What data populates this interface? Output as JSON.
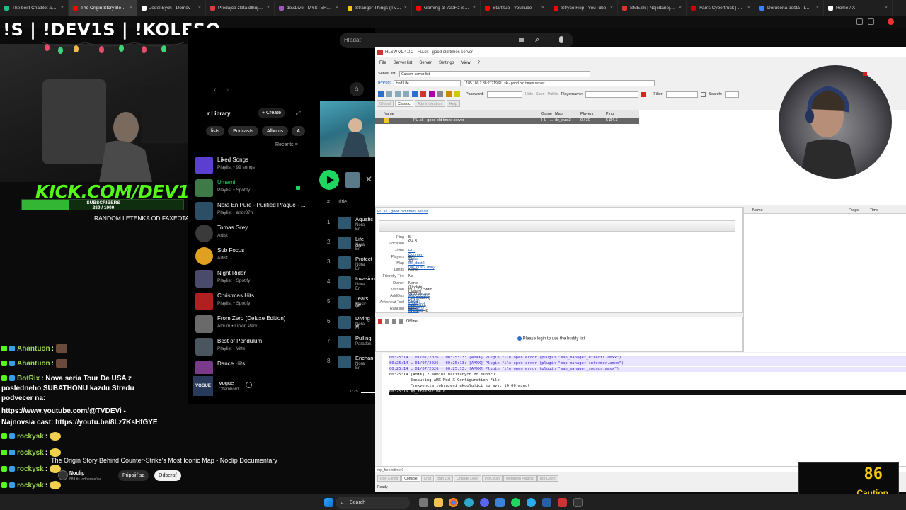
{
  "browser": {
    "tabs": [
      {
        "label": "The best ChatBot and ...",
        "color": "#19c37d"
      },
      {
        "label": "The Origin Story Behind ...",
        "color": "#ff0000",
        "active": true
      },
      {
        "label": "Jedel Bych - Domov",
        "color": "#ffffff"
      },
      {
        "label": "Predajca zlata dlhuje d...",
        "color": "#e03c3c"
      },
      {
        "label": "dev1live - MYSTERYBO...",
        "color": "#9b59b6"
      },
      {
        "label": "Stranger Things (TV Se...",
        "color": "#f5c518"
      },
      {
        "label": "Gaming at 720Hz is insa...",
        "color": "#ff0000"
      },
      {
        "label": "Startitup - YouTube",
        "color": "#ff0000"
      },
      {
        "label": "Strýco Filip - YouTube",
        "color": "#ff0000"
      },
      {
        "label": "SME.sk | Najčítanejšie s...",
        "color": "#e8302a"
      },
      {
        "label": "Ivan's Cybertruck | Tesla",
        "color": "#cc0000"
      },
      {
        "label": "Doručená pošta - Lazo...",
        "color": "#3b82f6"
      },
      {
        "label": "Home / X",
        "color": "#ffffff"
      }
    ]
  },
  "overlay": {
    "title": "!S | !DEV1S | !KOLESO",
    "kick": "KICK.COM/DEV1",
    "subs_label": "SUBSCRIBERS",
    "subs_count": "289 / 1000",
    "subs_progress": 0.289,
    "random_text": "RANDOM LETENKA OD FAXEOTA"
  },
  "chat": [
    {
      "user": "Ahantuon",
      "text": ":"
    },
    {
      "user": "Ahantuon",
      "text": ":"
    },
    {
      "user": "BotRix",
      "text": ": Nova seria Tour De USA z"
    },
    {
      "user": "",
      "text": "posledneho SUBATHONU kazdu Stredu"
    },
    {
      "user": "",
      "text": "podvecer na:"
    },
    {
      "user": "",
      "text": "https://www.youtube.com/@TVDEVi -"
    },
    {
      "user": "",
      "text": "Najnovsia cast: https://youtu.be/8Lz7KsHfGYE"
    },
    {
      "user": "rockysk",
      "text": ":"
    },
    {
      "user": "rockysk",
      "text": ":"
    },
    {
      "user": "rockysk",
      "text": ":"
    },
    {
      "user": "rockysk",
      "text": ":"
    },
    {
      "user": "rockysk",
      "text": ":"
    }
  ],
  "spotify": {
    "search_placeholder": "Hľadať",
    "library_title": "r Library",
    "create_label": "+ Create",
    "filters": [
      "lists",
      "Podcasts",
      "Albums",
      "A"
    ],
    "recents": "Recents",
    "items": [
      {
        "title": "Liked Songs",
        "sub": "Playlist • 99 songs",
        "color": "#5b3fd0"
      },
      {
        "title": "Umami",
        "sub": "Playlist • Spotify",
        "color": "#3d7a48",
        "active": true
      },
      {
        "title": "Nora En Pure - Purified Prague - ...",
        "sub": "Playlist • andr87h",
        "color": "#2d4f66"
      },
      {
        "title": "Tomas Grey",
        "sub": "Artist",
        "color": "#3a3a3a"
      },
      {
        "title": "Sub Focus",
        "sub": "Artist",
        "color": "#e0a020"
      },
      {
        "title": "Night Rider",
        "sub": "Playlist • Spotify",
        "color": "#4a4a6a"
      },
      {
        "title": "Christmas Hits",
        "sub": "Playlist • Spotify",
        "color": "#b02020"
      },
      {
        "title": "From Zero (Deluxe Edition)",
        "sub": "Album • Linkin Park",
        "color": "#6a6a6a"
      },
      {
        "title": "Best of Pendulum",
        "sub": "Playlist • Vifte",
        "color": "#4a5560"
      },
      {
        "title": "Dance Hits",
        "sub": "",
        "color": "#7a3a8a"
      }
    ],
    "track_header": "Title",
    "tracks": [
      {
        "num": "1",
        "title": "Aquatic",
        "artist": "Nora En"
      },
      {
        "num": "2",
        "title": "Life on",
        "artist": "Nora En"
      },
      {
        "num": "3",
        "title": "Protect",
        "artist": "Nora En"
      },
      {
        "num": "4",
        "title": "Invasion",
        "artist": "Nora En"
      },
      {
        "num": "5",
        "title": "Tears (w",
        "artist": "Music"
      },
      {
        "num": "6",
        "title": "Diving w",
        "artist": "Nora En"
      },
      {
        "num": "7",
        "title": "Pulling",
        "artist": "Paradok"
      },
      {
        "num": "8",
        "title": "Enchan",
        "artist": "Nora En"
      }
    ],
    "now_playing": {
      "title": "Vogue",
      "artist": "Chambord",
      "time": "0:25"
    }
  },
  "hlsw": {
    "title": "HLSW v1.4.0.2 - FU.sk - good old times server",
    "menu": [
      "File",
      "Server list",
      "Server",
      "Settings",
      "View",
      "?"
    ],
    "server_list_label": "Server list:",
    "server_list_value": "Custom server list",
    "ip_label": "IP/Port:",
    "game_value": "Half Life",
    "ip_value": "185.180.2.38:27219 FU.sk - good old times server",
    "password_label": "Password:",
    "playername_label": "Playername:",
    "filter_label": "Filter:",
    "search_label": "Search:",
    "view_tabs": [
      "Global",
      "Classic",
      "Administration",
      "Help"
    ],
    "columns": [
      "Name",
      "Game",
      "Map",
      "Players",
      "Ping"
    ],
    "server_row": {
      "name": "FU.sk - good old times server",
      "game": "HL - ...",
      "map": "de_dust2",
      "players": "0 / 30",
      "ping": "5 Ø4.3"
    },
    "info_link": "FU.sk - good old times server",
    "info": [
      {
        "label": "Ping",
        "value": "5 Ø4.3"
      },
      {
        "label": "Location",
        "value": ""
      },
      {
        "label": "Game",
        "value": "HL - Counter-Strike"
      },
      {
        "label": "Players",
        "value": "0 / 30"
      },
      {
        "label": "Map",
        "value": "de_dust2 (de_dust2.mid)"
      },
      {
        "label": "Limits",
        "value": "None"
      },
      {
        "label": "Friendly Fire",
        "value": "No"
      },
      {
        "label": "Owner",
        "value": "None (Update Owner)"
      },
      {
        "label": "Version",
        "value": "v1.1.2.7/Stdio 6153 secure (10) [RCON] Linux, Dedicated, Protocol 48"
      },
      {
        "label": "AddOns",
        "value": "AMXX/ODX v1.8.2, MetaMod v1.21p37"
      },
      {
        "label": "Anticheat Tool",
        "value": "Valve Anti-Cheat"
      },
      {
        "label": "Ranking",
        "value": "None"
      }
    ],
    "right_columns": [
      "Name",
      "Frags",
      "Time"
    ],
    "buddy_status": "Offline",
    "buddy_login": "Please login to use the buddy list",
    "console": [
      "00:25:14 L 01/07/2026 - 00:25:13: [AMXX] Plugin file open error (plugin \"map_manager_effects.amxx\")",
      "00:25:14 L 01/07/2026 - 00:25:13: [AMXX] Plugin file open error (plugin \"map_manager_informer.amxx\")",
      "00:25:14 L 01/07/2026 - 00:25:13: [AMXX] Plugin file open error (plugin \"map_manager_sounds.amxx\")",
      "00:25:14 [AMXX] 2 admins nacitanych zo suboru",
      "         Executing AMX Mod X Configuration File",
      "         Frekvencia zobrazeni akcolujici spravy: 10:00 minut",
      "00:25:16 mp_freezetime 0"
    ],
    "command_value": "mp_freezetime 0",
    "bottom_tabs": [
      "Icon Config",
      "Console",
      "Chat",
      "Ban List",
      "Change Level",
      "HBC Ban",
      "Metamod Plugins",
      "Rtp Client"
    ],
    "status": "Ready"
  },
  "video": {
    "title": "The Origin Story Behind Counter-Strike's Most Iconic Map - Noclip Documentary",
    "channel": "Noclip",
    "channel_sub": "889 tis. odberateľov",
    "join_label": "Pripojiť sa",
    "subscribe_label": "Odberať"
  },
  "caution": {
    "value": "86",
    "label": "Caution"
  },
  "taskbar": {
    "search_label": "Search"
  }
}
